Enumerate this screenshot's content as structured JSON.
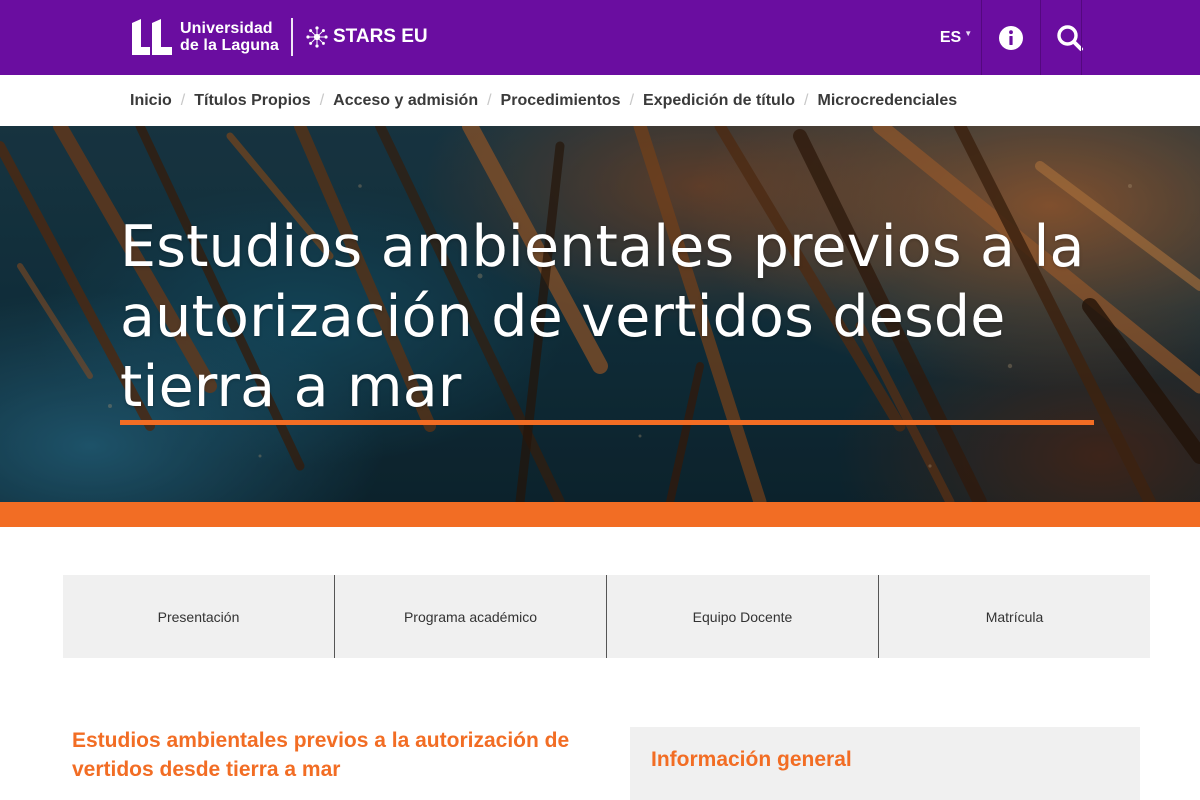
{
  "header": {
    "university_name_line1": "Universidad",
    "university_name_line2": "de la Laguna",
    "partner_name": "STARS EU",
    "language": "ES",
    "brand_color": "#6a0da0",
    "accent_color": "#f26d24",
    "icons": [
      "ull-logo-icon",
      "stars-eu-logo-icon",
      "chevron-down-icon",
      "info-icon",
      "search-icon"
    ]
  },
  "breadcrumb": [
    {
      "label": "Inicio"
    },
    {
      "label": "Títulos Propios"
    },
    {
      "label": "Acceso y admisión"
    },
    {
      "label": "Procedimientos"
    },
    {
      "label": "Expedición de título"
    },
    {
      "label": "Microcredenciales"
    }
  ],
  "hero": {
    "title": "Estudios ambientales previos a la autorización de vertidos desde tierra a mar"
  },
  "section_tabs": [
    {
      "label": "Presentación"
    },
    {
      "label": "Programa académico"
    },
    {
      "label": "Equipo Docente"
    },
    {
      "label": "Matrícula"
    }
  ],
  "content": {
    "title": "Estudios ambientales previos a la autorización de vertidos desde tierra a mar",
    "info_panel_title": "Información general"
  }
}
